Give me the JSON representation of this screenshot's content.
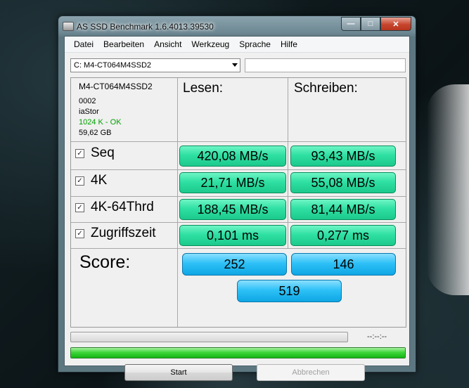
{
  "window": {
    "title": "AS SSD Benchmark 1.6.4013.39530"
  },
  "menu": [
    "Datei",
    "Bearbeiten",
    "Ansicht",
    "Werkzeug",
    "Sprache",
    "Hilfe"
  ],
  "drive": {
    "selected": "C: M4-CT064M4SSD2",
    "text_field": ""
  },
  "info": {
    "model": "M4-CT064M4SSD2",
    "firmware": "0002",
    "driver": "iaStor",
    "alignment": "1024 K - OK",
    "size": "59,62 GB"
  },
  "headers": {
    "read": "Lesen:",
    "write": "Schreiben:"
  },
  "tests": [
    {
      "label": "Seq",
      "checked": true,
      "read": "420,08 MB/s",
      "write": "93,43 MB/s"
    },
    {
      "label": "4K",
      "checked": true,
      "read": "21,71 MB/s",
      "write": "55,08 MB/s"
    },
    {
      "label": "4K-64Thrd",
      "checked": true,
      "read": "188,45 MB/s",
      "write": "81,44 MB/s"
    },
    {
      "label": "Zugriffszeit",
      "checked": true,
      "read": "0,101 ms",
      "write": "0,277 ms"
    }
  ],
  "score": {
    "label": "Score:",
    "read": "252",
    "write": "146",
    "total": "519"
  },
  "progress": {
    "time": "--:--:--",
    "main_fraction": 1.0
  },
  "buttons": {
    "start": "Start",
    "abort": "Abbrechen"
  },
  "colors": {
    "value_green": "#2fe0a3",
    "score_blue": "#2ec1f7",
    "progress_green": "#3ed63a",
    "ok_text": "#00a000"
  },
  "icons": {
    "checkbox": "✓"
  }
}
